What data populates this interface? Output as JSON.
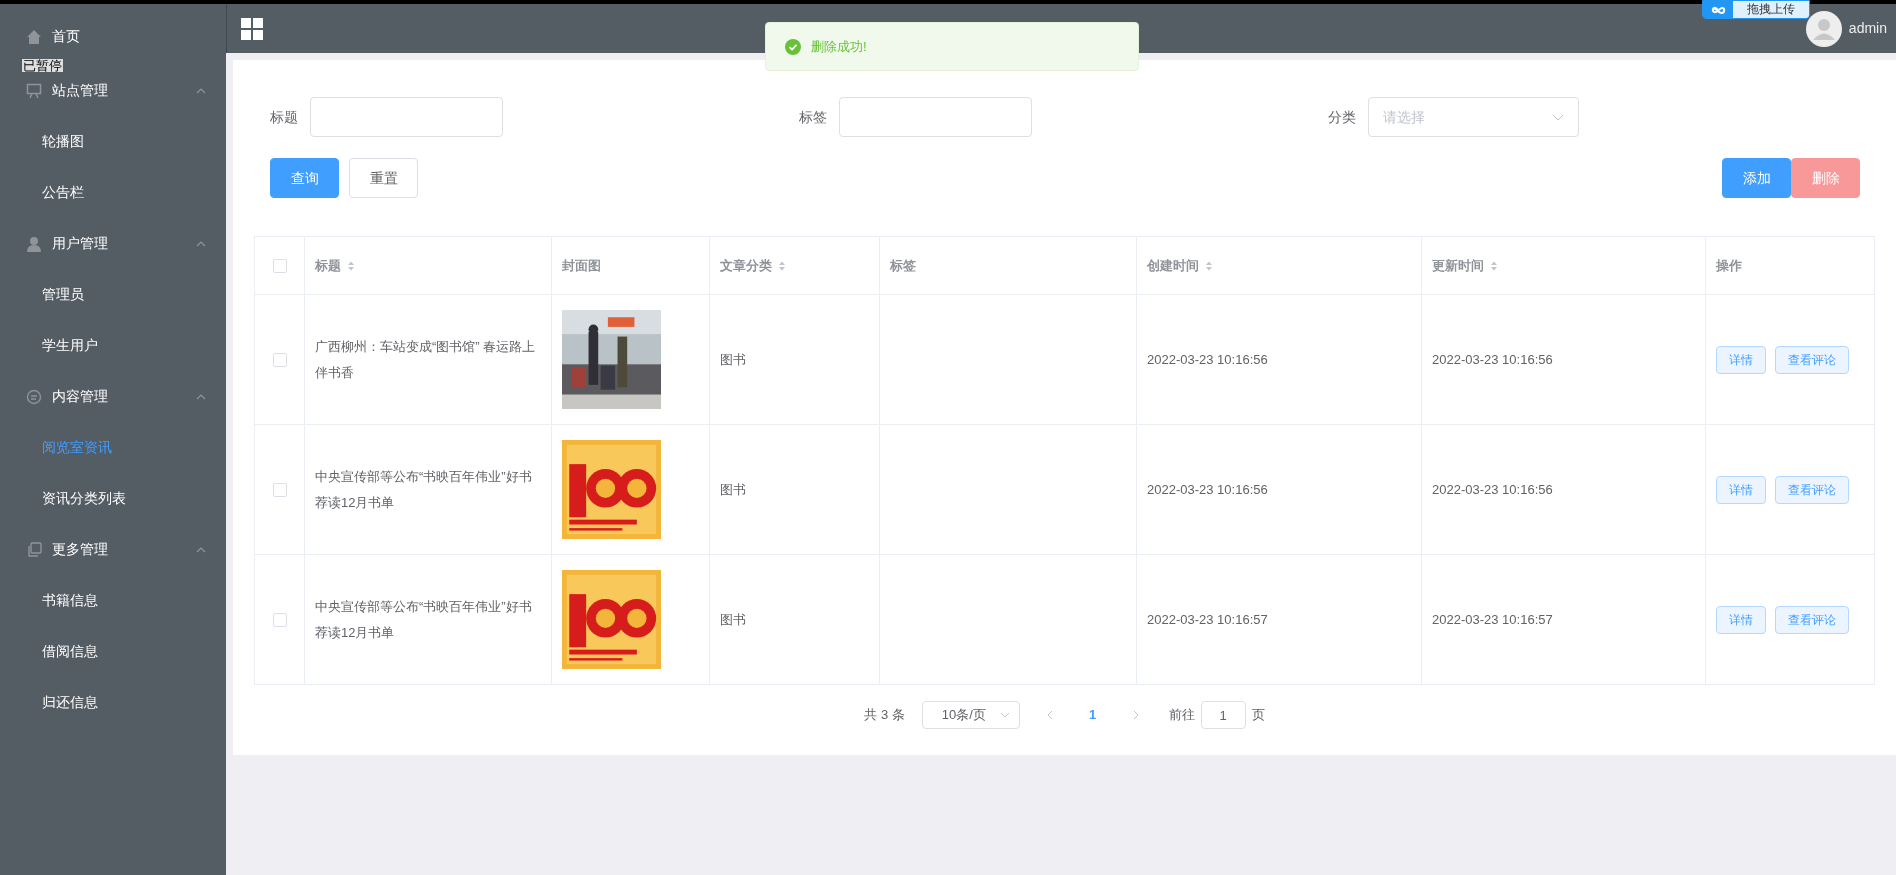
{
  "header": {
    "user": "admin"
  },
  "toast": {
    "message": "删除成功!"
  },
  "overlays": {
    "recorder_status": "已暂停",
    "upload_badge": "拖拽上传"
  },
  "sidebar": {
    "items": [
      {
        "label": "首页"
      },
      {
        "label": "站点管理",
        "expanded": true,
        "children": [
          {
            "label": "轮播图",
            "selected": false
          },
          {
            "label": "公告栏",
            "selected": false
          }
        ]
      },
      {
        "label": "用户管理",
        "expanded": true,
        "children": [
          {
            "label": "管理员",
            "selected": false
          },
          {
            "label": "学生用户",
            "selected": false
          }
        ]
      },
      {
        "label": "内容管理",
        "expanded": true,
        "children": [
          {
            "label": "阅览室资讯",
            "selected": true
          },
          {
            "label": "资讯分类列表",
            "selected": false
          }
        ]
      },
      {
        "label": "更多管理",
        "expanded": true,
        "children": [
          {
            "label": "书籍信息",
            "selected": false
          },
          {
            "label": "借阅信息",
            "selected": false
          },
          {
            "label": "归还信息",
            "selected": false
          }
        ]
      }
    ]
  },
  "filters": [
    {
      "kind": "text",
      "label": "标题"
    },
    {
      "kind": "text",
      "label": "标签"
    },
    {
      "kind": "select",
      "label": "分类",
      "placeholder": "请选择"
    }
  ],
  "search_buttons": [
    {
      "label": "查询",
      "kind": "primary"
    },
    {
      "label": "重置",
      "kind": "default"
    }
  ],
  "action_buttons": [
    {
      "label": "添加",
      "kind": "primary"
    },
    {
      "label": "删除",
      "kind": "danger"
    }
  ],
  "table": {
    "all_checked": false,
    "columns": [
      {
        "label": "标题",
        "sortable": true
      },
      {
        "label": "封面图",
        "sortable": false
      },
      {
        "label": "文章分类",
        "sortable": true
      },
      {
        "label": "标签",
        "sortable": false
      },
      {
        "label": "创建时间",
        "sortable": true
      },
      {
        "label": "更新时间",
        "sortable": true
      },
      {
        "label": "操作",
        "sortable": false
      }
    ],
    "rows": [
      {
        "checked": false,
        "title": "广西柳州：车站变成“图书馆” 春运路上伴书香",
        "cover": {
          "kind": "picture"
        },
        "category": "图书",
        "created": "2022-03-23 10:16:56",
        "updated": "2022-03-23 10:16:56",
        "actions": [
          "详情",
          "查看评论"
        ]
      },
      {
        "checked": false,
        "title": "中央宣传部等公布“书映百年伟业”好书荐读12月书单",
        "cover": {
          "kind": "picture"
        },
        "category": "图书",
        "created": "2022-03-23 10:16:56",
        "updated": "2022-03-23 10:16:56",
        "actions": [
          "详情",
          "查看评论"
        ]
      },
      {
        "checked": false,
        "title": "中央宣传部等公布“书映百年伟业”好书荐读12月书单",
        "cover": {
          "kind": "picture"
        },
        "category": "图书",
        "created": "2022-03-23 10:16:57",
        "updated": "2022-03-23 10:16:57",
        "actions": [
          "详情",
          "查看评论"
        ]
      }
    ]
  },
  "pagination": {
    "total": "共 3 条",
    "page_size": "10条/页",
    "pages": [
      {
        "label": "1",
        "selected": true
      }
    ],
    "goto_label": "前往",
    "goto_value": "1",
    "goto_suffix": "页"
  }
}
